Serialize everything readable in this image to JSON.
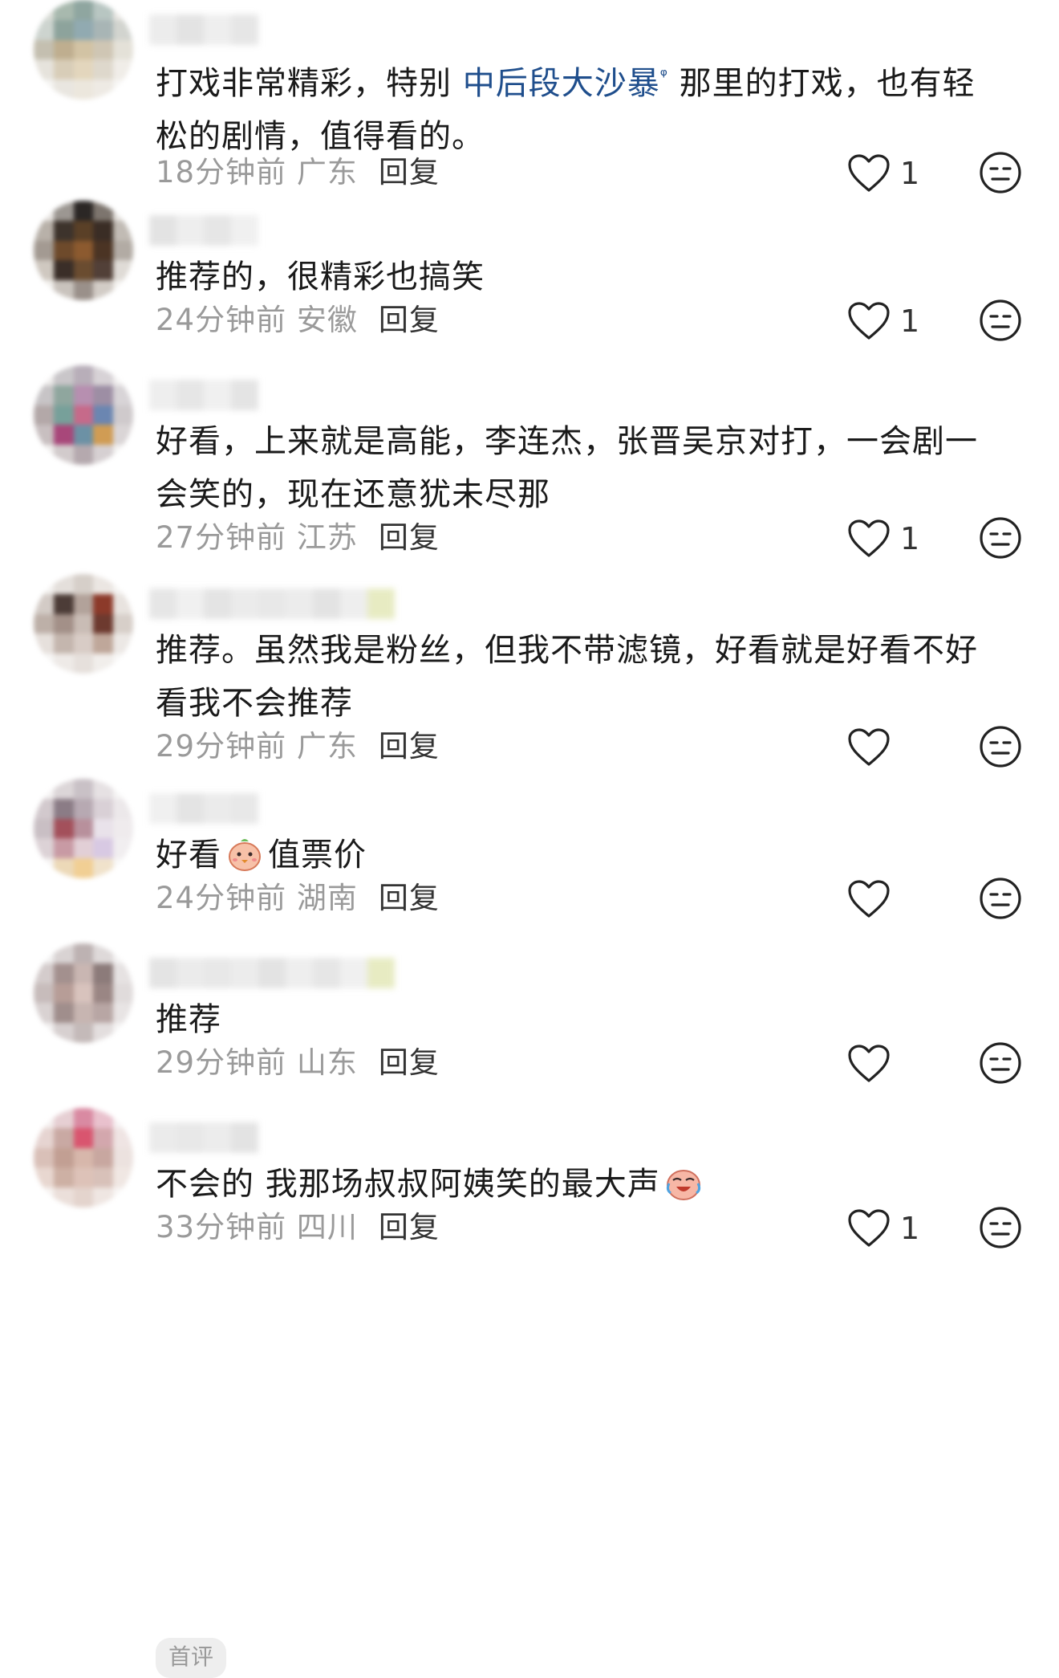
{
  "comments": [
    {
      "text_parts": [
        {
          "t": "打戏非常精彩，特别 "
        },
        {
          "t": "中后段大沙暴",
          "link": true
        },
        {
          "t": " 那里的打戏，也有轻"
        },
        {
          "t": "松的剧情，值得看的。",
          "newline": true
        }
      ],
      "time": "18分钟前",
      "location": "广东",
      "reply": "回复",
      "likes": "1",
      "avatar_colors": [
        "#d9dcd6",
        "#a8b9ae",
        "#8fa6a0",
        "#b8c6c2",
        "#e8e6e2",
        "#cdd4cf",
        "#8da39c",
        "#91aab1",
        "#a8b5b5",
        "#d2d4cf",
        "#c4bfb0",
        "#bfae8f",
        "#d2c3a4",
        "#cfc6b4",
        "#e4e1d8",
        "#e6e3dc",
        "#d8cdb8",
        "#e3d6bd",
        "#ded8cc",
        "#f0ede8",
        "#f4f3f1",
        "#e9e6e0",
        "#ece7dd",
        "#eeeae4",
        "#f6f5f3"
      ]
    },
    {
      "text_parts": [
        {
          "t": "推荐的，很精彩也搞笑"
        }
      ],
      "time": "24分钟前",
      "location": "安徽",
      "reply": "回复",
      "likes": "1",
      "avatar_colors": [
        "#e9e6e3",
        "#9c9792",
        "#2b2725",
        "#7d756e",
        "#e6e3df",
        "#b8b1a9",
        "#3d332c",
        "#5a4027",
        "#3a2d25",
        "#c1bbb4",
        "#a39a92",
        "#6e4a2b",
        "#8c5a2f",
        "#4b3424",
        "#b2aba4",
        "#cfc8c0",
        "#3a2e28",
        "#6a4c30",
        "#524038",
        "#dfdbd6",
        "#f1efec",
        "#c9c3bd",
        "#9a908a",
        "#d2ccc6",
        "#f3f1ee"
      ]
    },
    {
      "text_parts": [
        {
          "t": "好看，上来就是高能，李连杰，张晋吴京对打，一会剧一"
        },
        {
          "t": "会笑的，现在还意犹未尽那",
          "newline": true
        }
      ],
      "time": "27分钟前",
      "location": "江苏",
      "reply": "回复",
      "likes": "1",
      "avatar_colors": [
        "#eeeceb",
        "#c9c6c9",
        "#b8aeb9",
        "#d7d2d6",
        "#f2f0f0",
        "#c7c4c6",
        "#8fa69e",
        "#b78fb0",
        "#9d8ea4",
        "#d8d4d7",
        "#b3a8a8",
        "#77a09a",
        "#c66a8a",
        "#6b86b1",
        "#cfcacc",
        "#c8bfc0",
        "#a8477a",
        "#6c91a5",
        "#d09c54",
        "#dad5d6",
        "#f0eeed",
        "#d2cbcc",
        "#b5a9ae",
        "#d6d0d2",
        "#f3f2f1"
      ]
    },
    {
      "text_parts": [
        {
          "t": "推荐。虽然我是粉丝，但我不带滤镜，好看就是好看不好"
        },
        {
          "t": "看我不会推荐",
          "newline": true
        }
      ],
      "time": "29分钟前",
      "location": "广东",
      "reply": "回复",
      "likes": "",
      "avatar_colors": [
        "#f3f1ef",
        "#e4dfdb",
        "#d6cfc9",
        "#ebe6e2",
        "#f5f4f2",
        "#d3cbc6",
        "#4c3c37",
        "#b2a29a",
        "#8c3a2a",
        "#e8e3df",
        "#bdb0a8",
        "#a39088",
        "#c9bcb5",
        "#6d3a2f",
        "#d7cfc9",
        "#e6e0dc",
        "#c4b6ae",
        "#d8ccc6",
        "#bfa79a",
        "#ece8e5",
        "#f6f5f4",
        "#eeeae7",
        "#e6e0dc",
        "#f1eeeb",
        "#f8f7f6"
      ]
    },
    {
      "text_parts": [
        {
          "t": "好看"
        },
        {
          "emoji": "chick"
        },
        {
          "t": "值票价"
        }
      ],
      "time": "24分钟前",
      "location": "湖南",
      "reply": "回复",
      "likes": "",
      "avatar_colors": [
        "#f4f2f2",
        "#dcd6d8",
        "#c9c1c6",
        "#e6e1e3",
        "#f5f4f4",
        "#d2c9cd",
        "#8b7c86",
        "#b7a9b2",
        "#d9d0d6",
        "#ece8ea",
        "#c9bfc4",
        "#a3505b",
        "#b8909c",
        "#e9e2ea",
        "#efebed",
        "#dcd2d6",
        "#c89aa4",
        "#e2cfd6",
        "#d8c9e3",
        "#f1eef0",
        "#f6f4f3",
        "#ecd9b8",
        "#f1cf94",
        "#f0e2cb",
        "#f8f7f6"
      ]
    },
    {
      "text_parts": [
        {
          "t": "推荐"
        }
      ],
      "time": "29分钟前",
      "location": "山东",
      "reply": "回复",
      "likes": "",
      "avatar_colors": [
        "#f1f0f0",
        "#d9d3d3",
        "#bdb2b2",
        "#ded9d9",
        "#f4f3f3",
        "#d4cccc",
        "#a3908e",
        "#c9b6b2",
        "#8c7b7a",
        "#e6e2e2",
        "#c7bcbb",
        "#b79d97",
        "#d8c3bd",
        "#9a8684",
        "#e0dbdb",
        "#d9d2d2",
        "#a08e8c",
        "#c7b5b1",
        "#b8a6a4",
        "#e8e4e4",
        "#f2f0f0",
        "#d7d0d0",
        "#c4bab9",
        "#e3dede",
        "#f5f4f4"
      ]
    },
    {
      "text_parts": [
        {
          "t": "不会的 我那场叔叔阿姨笑的最大声"
        },
        {
          "emoji": "cry"
        }
      ],
      "time": "33分钟前",
      "location": "四川",
      "reply": "回复",
      "likes": "1",
      "avatar_colors": [
        "#f4efef",
        "#e6cfd3",
        "#d98aa2",
        "#e9c1cd",
        "#f6f1f2",
        "#e6d4d1",
        "#c9a9a3",
        "#d9556f",
        "#d3a7ad",
        "#efe4e3",
        "#d9c0b8",
        "#c29f93",
        "#d7b7ab",
        "#c8a7a0",
        "#ece2df",
        "#e8d7d0",
        "#cdb0a4",
        "#ddc2b8",
        "#d8c1b9",
        "#f0e7e3",
        "#f6f2f0",
        "#ebdfda",
        "#e4d4cd",
        "#efe6e2",
        "#f8f5f4"
      ]
    }
  ],
  "bottom_pill": "首评",
  "colors": {
    "link": "#1f4e8c",
    "meta": "#9a9a9a",
    "text": "#1a1a1a"
  },
  "icons": {
    "like": "heart-outline-icon",
    "dislike": "meh-face-icon"
  }
}
